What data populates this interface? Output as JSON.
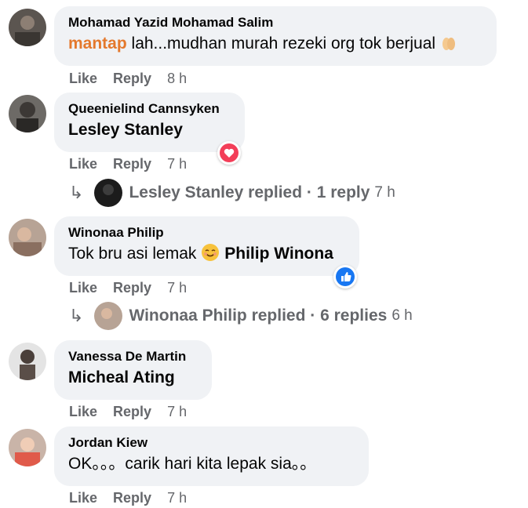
{
  "comments": [
    {
      "author": "Mohamad Yazid Mohamad Salim",
      "text_highlight": "mantap",
      "text": " lah...mudhan murah rezeki org tok berjual",
      "actions": {
        "like": "Like",
        "reply": "Reply",
        "time": "8 h"
      }
    },
    {
      "author": "Queenielind Cannsyken",
      "mention": "Lesley Stanley",
      "actions": {
        "like": "Like",
        "reply": "Reply",
        "time": "7 h"
      },
      "reaction": "love",
      "replies": {
        "label": "Lesley Stanley replied · 1 reply",
        "time": "7 h"
      }
    },
    {
      "author": "Winonaa Philip",
      "text": "Tok bru asi lemak ",
      "mention": "Philip Winona",
      "actions": {
        "like": "Like",
        "reply": "Reply",
        "time": "7 h"
      },
      "reaction": "like",
      "replies": {
        "label": "Winonaa Philip replied · 6 replies",
        "time": "6 h"
      }
    },
    {
      "author": "Vanessa De Martin",
      "mention": "Micheal Ating",
      "actions": {
        "like": "Like",
        "reply": "Reply",
        "time": "7 h"
      }
    },
    {
      "author": "Jordan Kiew",
      "text": "OK。。。carik hari kita lepak sia。。",
      "actions": {
        "like": "Like",
        "reply": "Reply",
        "time": "7 h"
      }
    }
  ],
  "colors": {
    "bubble": "#f0f2f5",
    "secondary_text": "#65676b",
    "highlight": "#e4792d",
    "love": "#f33e58",
    "like": "#1877f2"
  }
}
